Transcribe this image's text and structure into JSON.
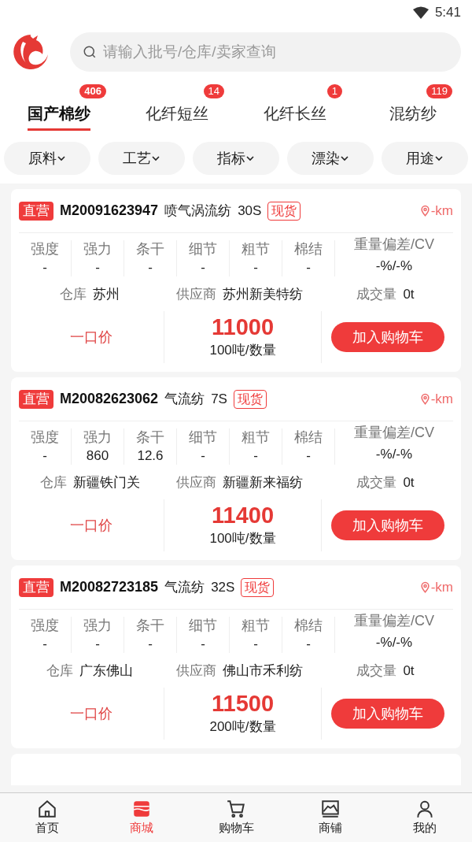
{
  "status_bar": {
    "time": "5:41"
  },
  "search": {
    "placeholder": "请输入批号/仓库/卖家查询"
  },
  "tabs": [
    {
      "label": "国产棉纱",
      "count": "406",
      "selected": true
    },
    {
      "label": "化纤短丝",
      "count": "14",
      "selected": false
    },
    {
      "label": "化纤长丝",
      "count": "1",
      "selected": false
    },
    {
      "label": "混纺纱",
      "count": "119",
      "selected": false
    }
  ],
  "filters": [
    "原料",
    "工艺",
    "指标",
    "漂染",
    "用途"
  ],
  "products": [
    {
      "tag": "直营",
      "batch": "M20091623947",
      "process": "喷气涡流纺",
      "count": "30S",
      "stock": "现货",
      "distance": "-km",
      "metrics": [
        {
          "label": "强度",
          "value": "-"
        },
        {
          "label": "强力",
          "value": "-"
        },
        {
          "label": "条干",
          "value": "-"
        },
        {
          "label": "细节",
          "value": "-"
        },
        {
          "label": "粗节",
          "value": "-"
        },
        {
          "label": "棉结",
          "value": "-"
        }
      ],
      "deviation": {
        "label": "重量偏差/CV",
        "value": "-%/-%"
      },
      "warehouse": {
        "label": "仓库",
        "value": "苏州"
      },
      "supplier": {
        "label": "供应商",
        "value": "苏州新美特纺"
      },
      "volume": {
        "label": "成交量",
        "value": "0t"
      },
      "price_type": "一口价",
      "price": "11000",
      "quantity": "100吨/数量",
      "button": "加入购物车"
    },
    {
      "tag": "直营",
      "batch": "M20082623062",
      "process": "气流纺",
      "count": "7S",
      "stock": "现货",
      "distance": "-km",
      "metrics": [
        {
          "label": "强度",
          "value": "-"
        },
        {
          "label": "强力",
          "value": "860"
        },
        {
          "label": "条干",
          "value": "12.6"
        },
        {
          "label": "细节",
          "value": "-"
        },
        {
          "label": "粗节",
          "value": "-"
        },
        {
          "label": "棉结",
          "value": "-"
        }
      ],
      "deviation": {
        "label": "重量偏差/CV",
        "value": "-%/-%"
      },
      "warehouse": {
        "label": "仓库",
        "value": "新疆铁门关"
      },
      "supplier": {
        "label": "供应商",
        "value": "新疆新来福纺"
      },
      "volume": {
        "label": "成交量",
        "value": "0t"
      },
      "price_type": "一口价",
      "price": "11400",
      "quantity": "100吨/数量",
      "button": "加入购物车"
    },
    {
      "tag": "直营",
      "batch": "M20082723185",
      "process": "气流纺",
      "count": "32S",
      "stock": "现货",
      "distance": "-km",
      "metrics": [
        {
          "label": "强度",
          "value": "-"
        },
        {
          "label": "强力",
          "value": "-"
        },
        {
          "label": "条干",
          "value": "-"
        },
        {
          "label": "细节",
          "value": "-"
        },
        {
          "label": "粗节",
          "value": "-"
        },
        {
          "label": "棉结",
          "value": "-"
        }
      ],
      "deviation": {
        "label": "重量偏差/CV",
        "value": "-%/-%"
      },
      "warehouse": {
        "label": "仓库",
        "value": "广东佛山"
      },
      "supplier": {
        "label": "供应商",
        "value": "佛山市禾利纺"
      },
      "volume": {
        "label": "成交量",
        "value": "0t"
      },
      "price_type": "一口价",
      "price": "11500",
      "quantity": "200吨/数量",
      "button": "加入购物车"
    }
  ],
  "bottom_nav": [
    {
      "kind": "home",
      "label": "首页",
      "selected": false
    },
    {
      "kind": "mall",
      "label": "商城",
      "selected": true
    },
    {
      "kind": "cart",
      "label": "购物车",
      "selected": false
    },
    {
      "kind": "shop",
      "label": "商铺",
      "selected": false
    },
    {
      "kind": "me",
      "label": "我的",
      "selected": false
    }
  ]
}
